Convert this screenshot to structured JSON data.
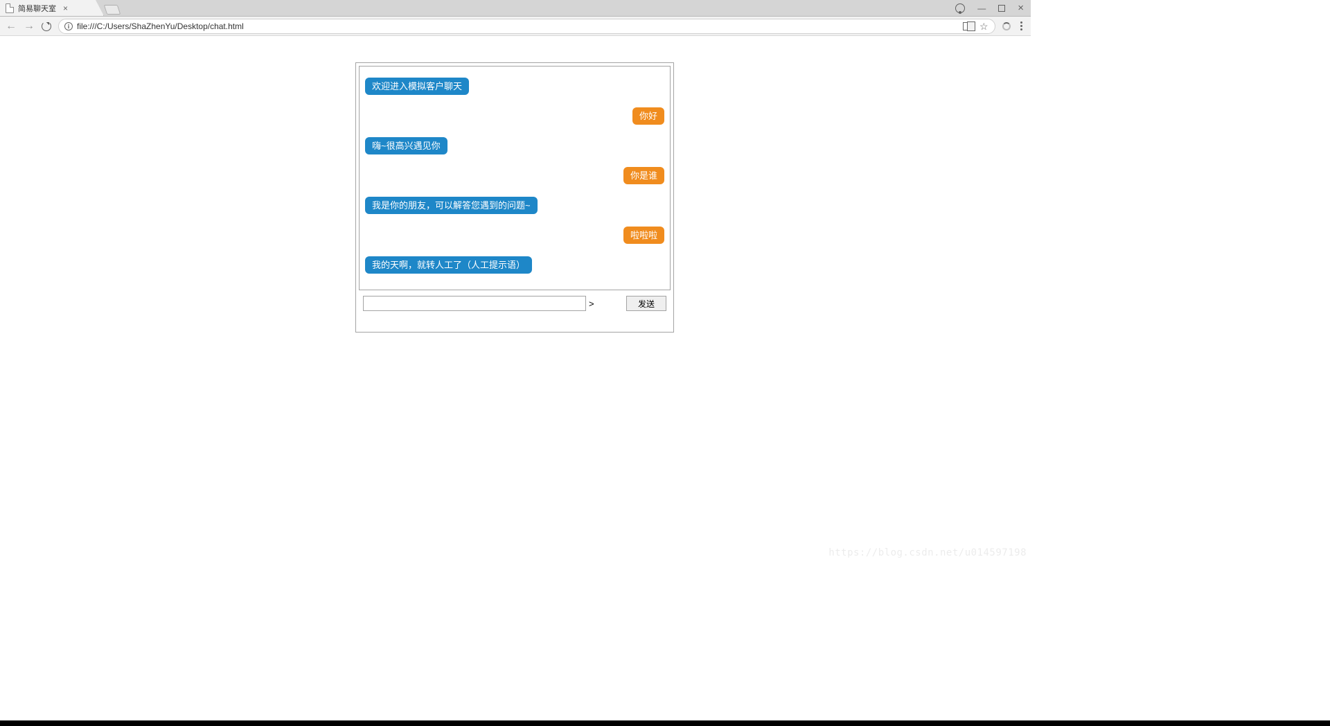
{
  "browser": {
    "tab_title": "简易聊天室",
    "url": "file:///C:/Users/ShaZhenYu/Desktop/chat.html"
  },
  "chat": {
    "messages": [
      {
        "side": "left",
        "text": "欢迎进入模拟客户聊天"
      },
      {
        "side": "right",
        "text": "你好"
      },
      {
        "side": "left",
        "text": "嗨~很高兴遇见你"
      },
      {
        "side": "right",
        "text": "你是谁"
      },
      {
        "side": "left",
        "text": "我是你的朋友，可以解答您遇到的问题~"
      },
      {
        "side": "right",
        "text": "啦啦啦"
      },
      {
        "side": "left",
        "text": "我的天啊，就转人工了（人工提示语）"
      }
    ],
    "input_value": "",
    "arrow": ">",
    "send_label": "发送"
  },
  "watermark": "https://blog.csdn.net/u014597198"
}
